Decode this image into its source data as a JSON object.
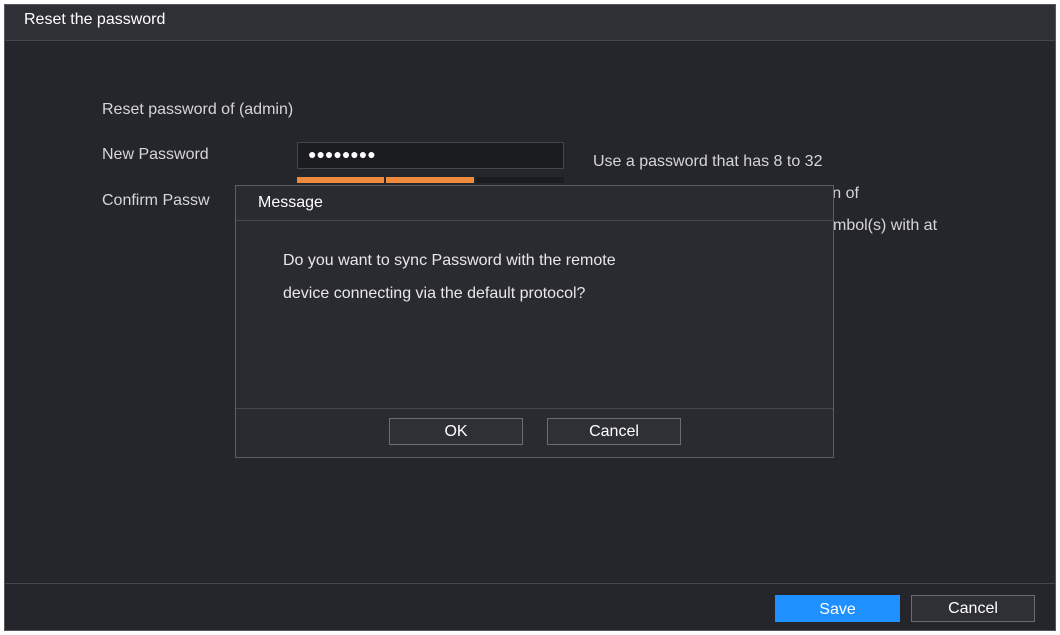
{
  "window": {
    "title": "Reset the password"
  },
  "form": {
    "reset_label": "Reset password of (admin)",
    "new_password_label": "New Password",
    "new_password_value": "●●●●●●●●",
    "confirm_password_label": "Confirm Passw",
    "hint_line1": "Use a password that has 8 to 32",
    "hint_line2": "characters, it can be a combination of",
    "hint_line3": "mbol(s) with at"
  },
  "strength_colors": {
    "active": "#f08a3c",
    "inactive": "#1b1c20"
  },
  "dialog": {
    "title": "Message",
    "message_line1": "Do you want to sync Password with the remote",
    "message_line2": "device connecting via the default protocol?",
    "ok_label": "OK",
    "cancel_label": "Cancel"
  },
  "footer": {
    "save_label": "Save",
    "cancel_label": "Cancel"
  },
  "colors": {
    "primary_button": "#1e90ff",
    "background": "#25262b"
  }
}
